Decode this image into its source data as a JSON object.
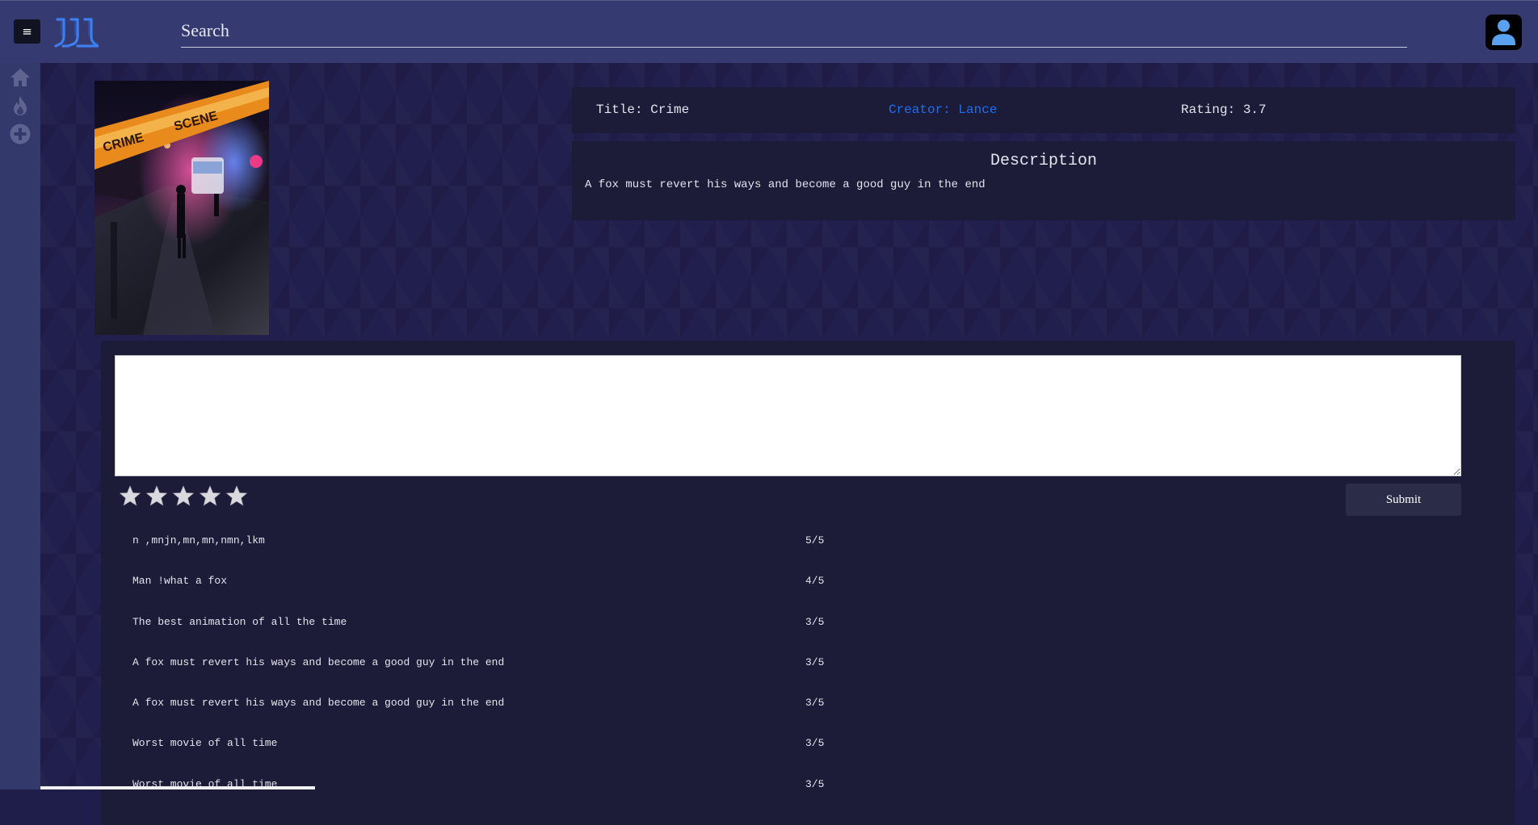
{
  "header": {
    "menu_icon": "≡",
    "logo_icon": "jjj-logo",
    "search_placeholder": "Search",
    "avatar_icon": "user-icon"
  },
  "sidebar": {
    "items": [
      {
        "icon": "home-icon"
      },
      {
        "icon": "fire-icon"
      },
      {
        "icon": "plus-circle-icon"
      }
    ]
  },
  "movie": {
    "poster_alt": "crime-scene-poster",
    "title": "Title: Crime",
    "creator": "Creator: Lance",
    "rating": "Rating: 3.7",
    "description_heading": "Description",
    "description": "A fox must revert his ways and become a good guy in the end"
  },
  "review_form": {
    "text_value": "",
    "star_count": 5,
    "selected_stars": 0,
    "submit_label": "Submit"
  },
  "reviews": [
    {
      "text": "n ,mnjn,mn,mn,nmn,lkm",
      "score": "5/5"
    },
    {
      "text": "Man !what a fox",
      "score": "4/5"
    },
    {
      "text": "The best animation of all the time",
      "score": "3/5"
    },
    {
      "text": "A fox must revert his ways and become a good guy in the end",
      "score": "3/5"
    },
    {
      "text": "A fox must revert his ways and become a good guy in the end",
      "score": "3/5"
    },
    {
      "text": "Worst movie of all time",
      "score": "3/5"
    },
    {
      "text": "Worst movie of all time",
      "score": "3/5"
    }
  ],
  "colors": {
    "topbar": "#353b70",
    "background": "#211f4d",
    "panel": "#1c1b38",
    "link": "#1d6ff2"
  }
}
